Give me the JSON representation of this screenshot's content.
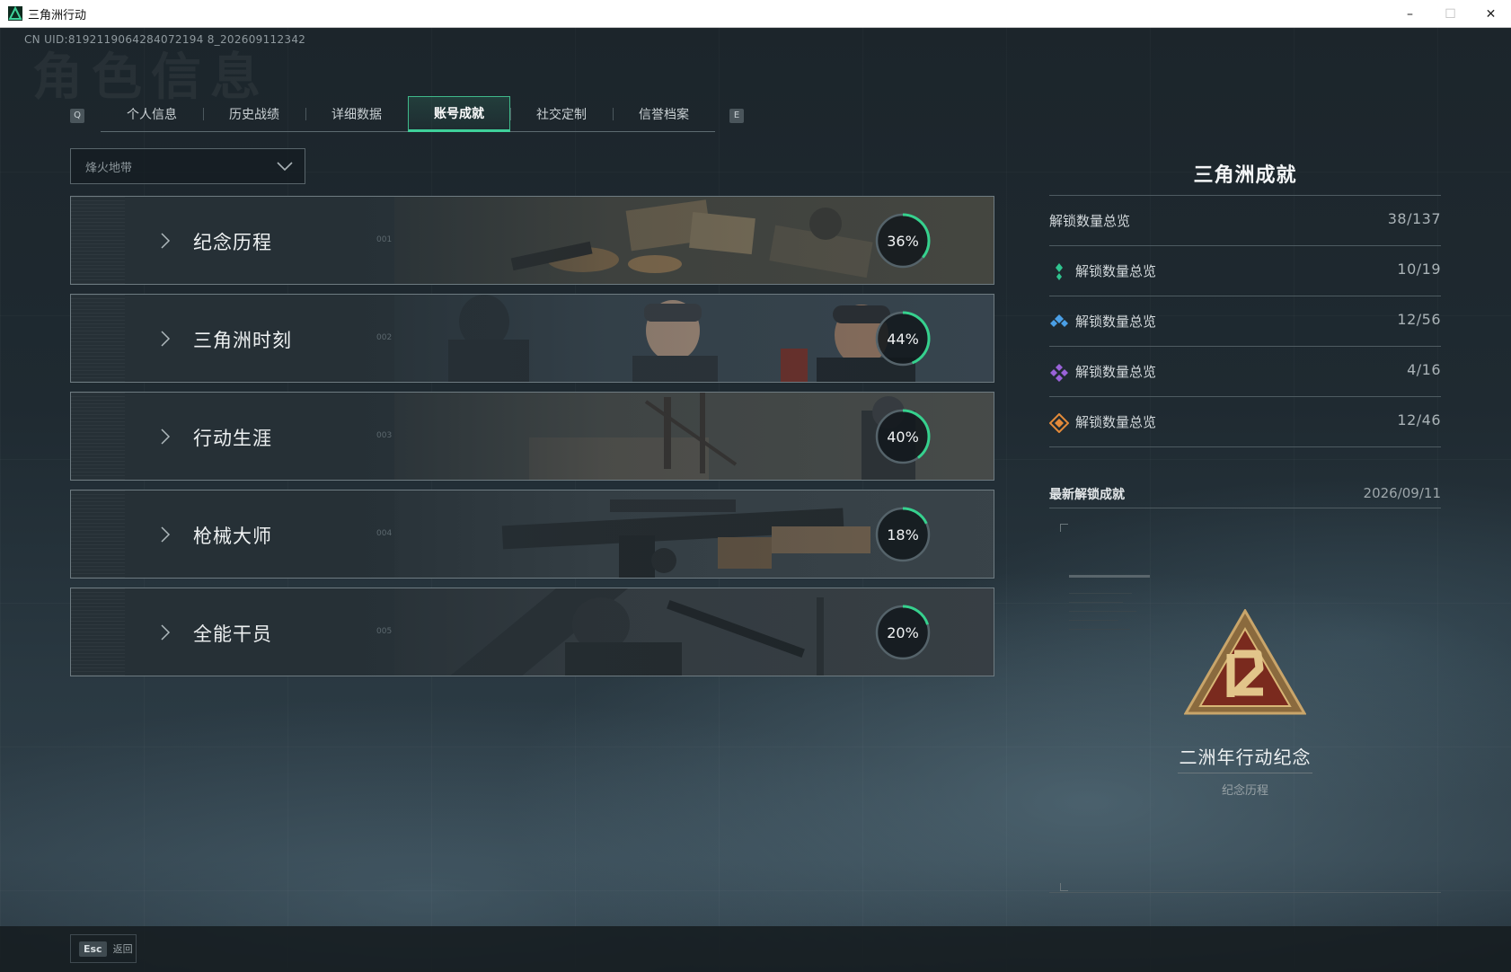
{
  "window": {
    "title": "三角洲行动",
    "minimize": "–",
    "maximize": "☐",
    "close": "✕"
  },
  "uid": "CN UID:8192119064284072194 8_202609112342",
  "ghost_title": "角色信息",
  "tabs": {
    "left_key": "Q",
    "right_key": "E",
    "items": [
      {
        "label": "个人信息"
      },
      {
        "label": "历史战绩"
      },
      {
        "label": "详细数据"
      },
      {
        "label": "账号成就",
        "active": true
      },
      {
        "label": "社交定制"
      },
      {
        "label": "信誉档案"
      }
    ]
  },
  "mode_select": {
    "value": "烽火地带"
  },
  "categories": [
    {
      "name": "纪念历程",
      "index": "001",
      "progress": 36,
      "progress_label": "36%"
    },
    {
      "name": "三角洲时刻",
      "index": "002",
      "progress": 44,
      "progress_label": "44%"
    },
    {
      "name": "行动生涯",
      "index": "003",
      "progress": 40,
      "progress_label": "40%"
    },
    {
      "name": "枪械大师",
      "index": "004",
      "progress": 18,
      "progress_label": "18%"
    },
    {
      "name": "全能干员",
      "index": "005",
      "progress": 20,
      "progress_label": "20%"
    }
  ],
  "summary": {
    "title": "三角洲成就",
    "total": {
      "label": "解锁数量总览",
      "value": "38/137"
    },
    "tiers": [
      {
        "label": "解锁数量总览",
        "value": "10/19",
        "icon": "green-tier-icon",
        "color": "#2fc48f"
      },
      {
        "label": "解锁数量总览",
        "value": "12/56",
        "icon": "blue-tier-icon",
        "color": "#4a9fe6"
      },
      {
        "label": "解锁数量总览",
        "value": "4/16",
        "icon": "purple-tier-icon",
        "color": "#9a62d8"
      },
      {
        "label": "解锁数量总览",
        "value": "12/46",
        "icon": "gold-tier-icon",
        "color": "#e38a3a"
      }
    ]
  },
  "recent": {
    "label": "最新解锁成就",
    "date": "2026/09/11",
    "achievement": {
      "name": "二洲年行动纪念",
      "category": "纪念历程",
      "icon": "anniversary-emblem-icon"
    }
  },
  "footer": {
    "esc_key": "Esc",
    "back_label": "返回"
  },
  "colors": {
    "accent": "#3fd19a",
    "ring_track": "#1e262b",
    "ring_fill": "#36d18e"
  }
}
